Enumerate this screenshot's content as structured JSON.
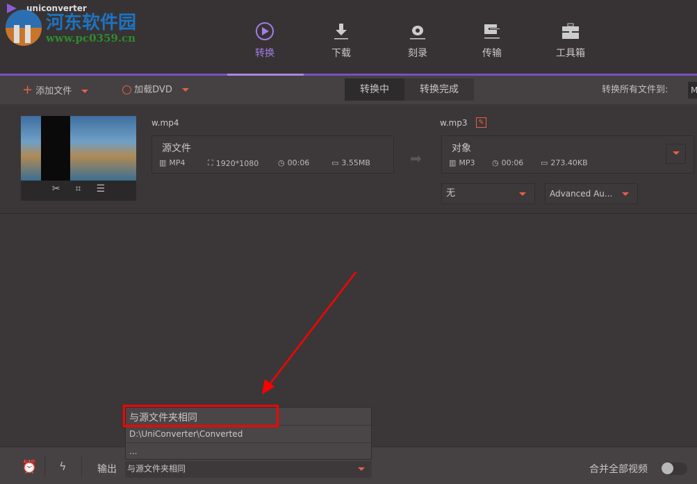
{
  "app": {
    "name": "uniconverter"
  },
  "watermark": {
    "name": "河东软件园",
    "url": "www.pc0359.cn"
  },
  "nav": [
    {
      "label": "转换",
      "icon": "convert-icon",
      "active": true
    },
    {
      "label": "下载",
      "icon": "download-icon"
    },
    {
      "label": "刻录",
      "icon": "burn-icon"
    },
    {
      "label": "传输",
      "icon": "transfer-icon"
    },
    {
      "label": "工具箱",
      "icon": "toolbox-icon"
    }
  ],
  "toolbar": {
    "add_file": "添加文件",
    "load_dvd": "加载DVD",
    "tabs": [
      "转换中",
      "转换完成"
    ],
    "convert_all_label": "转换所有文件到:",
    "convert_all_value": "M"
  },
  "file": {
    "source_name": "w.mp4",
    "source_label": "源文件",
    "source_format": "MP4",
    "source_resolution": "1920*1080",
    "source_duration": "00:06",
    "source_size": "3.55MB",
    "target_name": "w.mp3",
    "target_label": "对象",
    "target_format": "MP3",
    "target_duration": "00:06",
    "target_size": "273.40KB",
    "subtitle_select": "无",
    "audio_select": "Advanced Au..."
  },
  "output": {
    "label": "输出",
    "value": "与源文件夹相同",
    "options": [
      "与源文件夹相同",
      "D:\\UniConverter\\Converted",
      "..."
    ]
  },
  "merge": {
    "label": "合并全部视频",
    "on": false
  },
  "colors": {
    "accent": "#7a50c2",
    "orange": "#e8604a",
    "annotation": "#ff0000"
  }
}
